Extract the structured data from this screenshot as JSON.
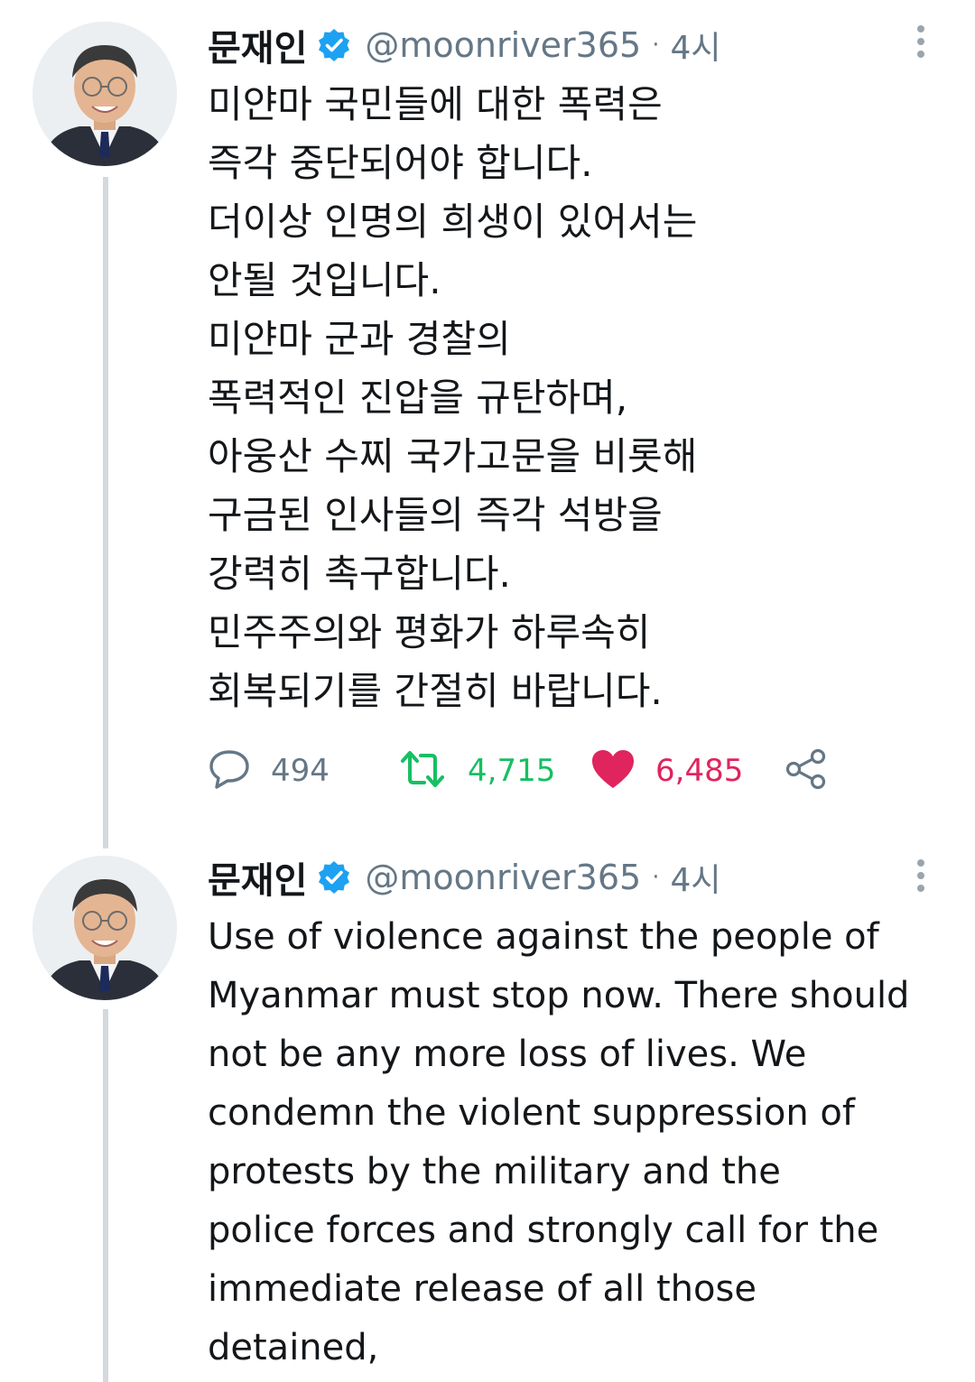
{
  "colors": {
    "verified": "#1da1f2",
    "retweet": "#17bf63",
    "like": "#e0245e",
    "secondary_text": "#657786",
    "thread_line": "#d4d9dd"
  },
  "tweets": [
    {
      "author": {
        "name": "문재인",
        "handle": "@moonriver365",
        "verified_icon": "verified-badge-icon"
      },
      "separator": "·",
      "time": "4시",
      "lines": [
        "미얀마 국민들에 대한 폭력은",
        "즉각 중단되어야 합니다.",
        "더이상 인명의 희생이 있어서는",
        "안될 것입니다.",
        "미얀마 군과 경찰의",
        "폭력적인 진압을 규탄하며,",
        "아웅산 수찌 국가고문을 비롯해",
        "구금된 인사들의 즉각 석방을",
        "강력히 촉구합니다.",
        "민주주의와 평화가 하루속히",
        "회복되기를 간절히 바랍니다."
      ],
      "stats": {
        "replies": "494",
        "retweets": "4,715",
        "likes": "6,485"
      },
      "liked": true
    },
    {
      "author": {
        "name": "문재인",
        "handle": "@moonriver365",
        "verified_icon": "verified-badge-icon"
      },
      "separator": "·",
      "time": "4시",
      "lines": [
        "Use of violence against the people of",
        "Myanmar must stop now. There should",
        "not be any more loss of lives. We",
        "condemn the violent suppression of",
        "protests by the military and the",
        "police forces and strongly call for the",
        "immediate release of all those",
        "detained,"
      ]
    }
  ]
}
